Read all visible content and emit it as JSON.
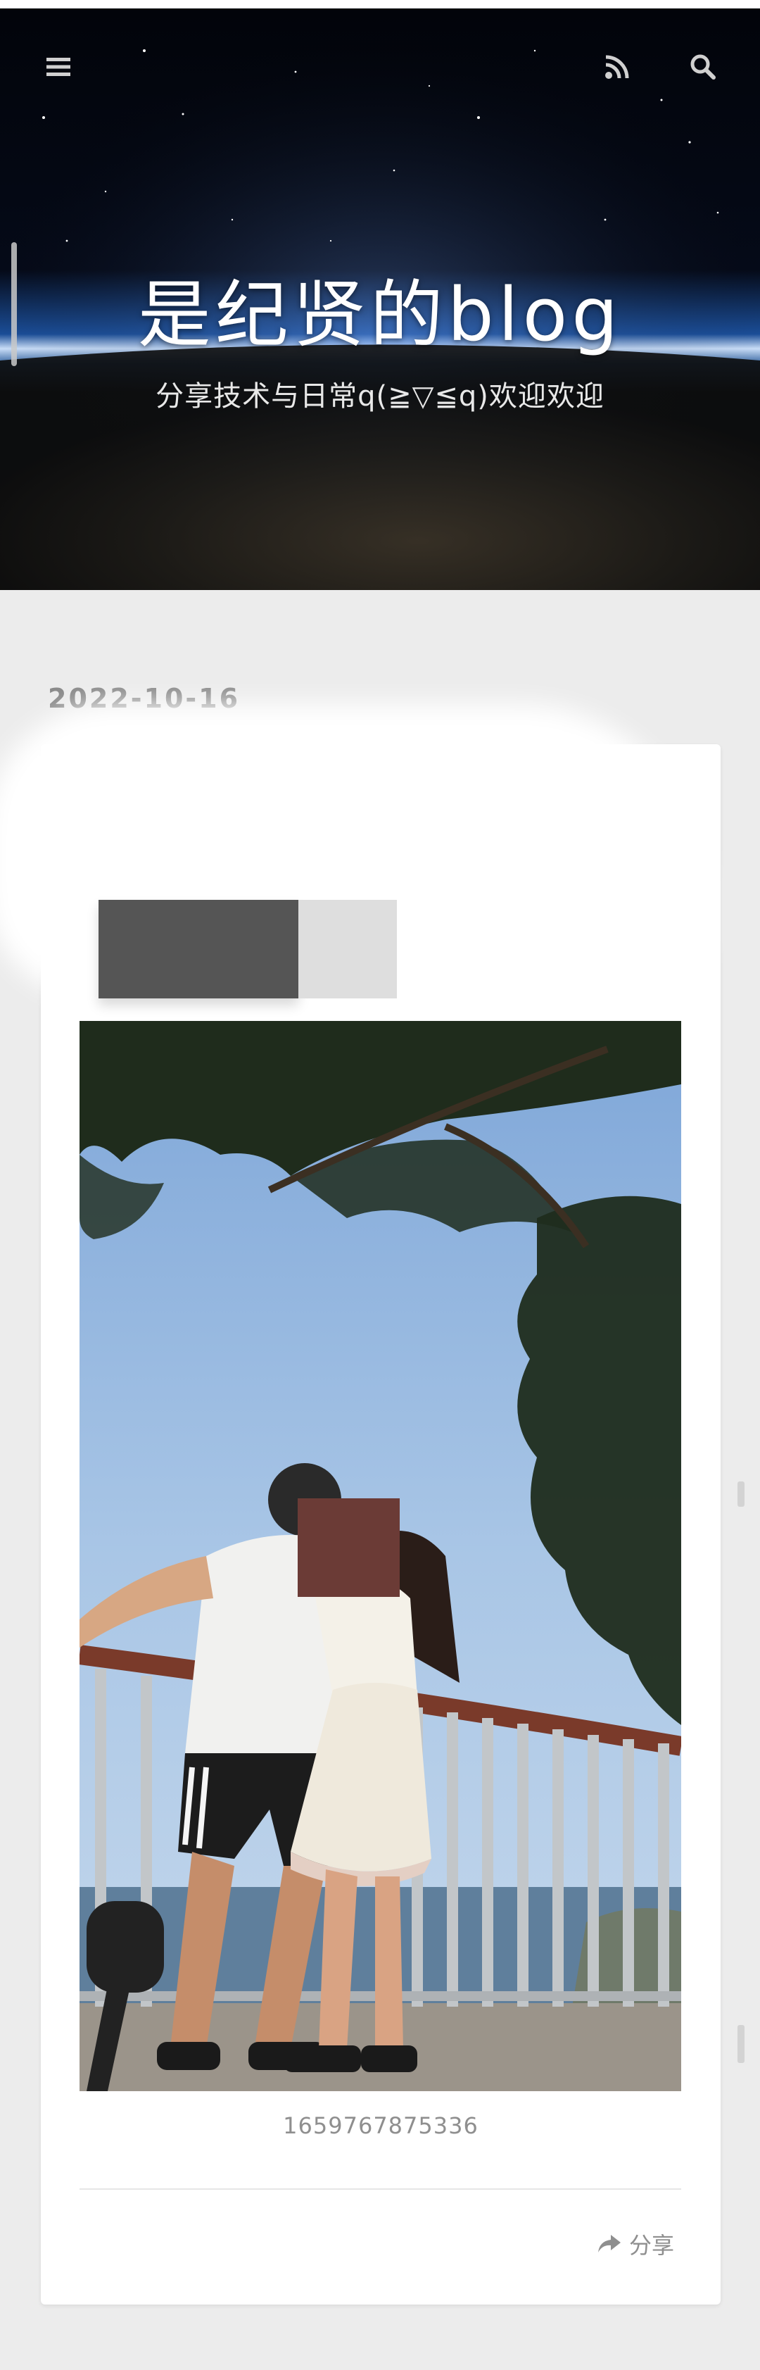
{
  "header": {
    "title": "是纪贤的blog",
    "subtitle": "分享技术与日常q(≧▽≦q)欢迎欢迎",
    "icons": {
      "menu": "menu-icon",
      "rss": "rss-icon",
      "search": "search-icon"
    }
  },
  "post": {
    "date": "2022-10-16",
    "image_caption": "1659767875336",
    "share_label": "分享",
    "share_icon": "share-icon"
  },
  "colors": {
    "page_background": "#ececec",
    "card_background": "#ffffff",
    "meta_text": "#8a8a8a"
  }
}
